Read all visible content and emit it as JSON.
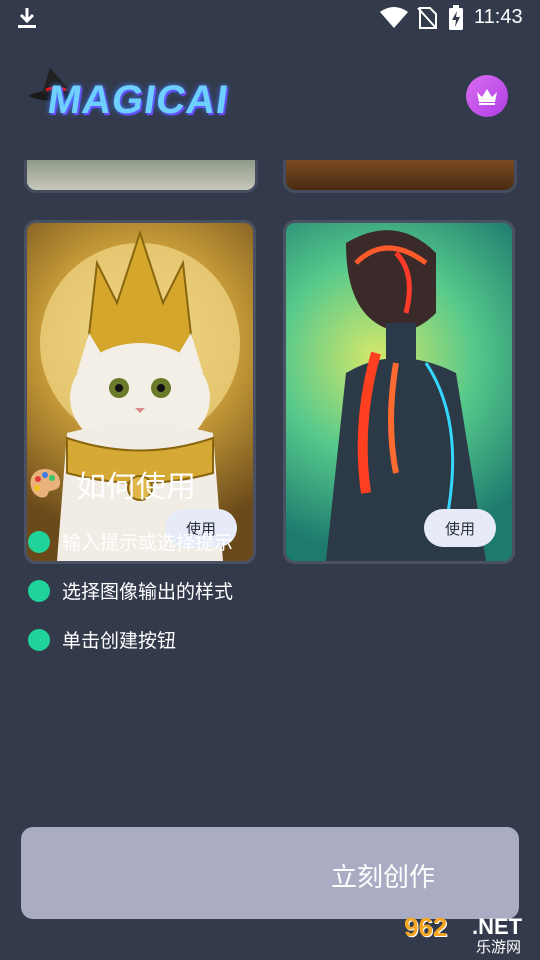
{
  "status_bar": {
    "time": "11:43"
  },
  "header": {
    "logo_text": "MAGICAI"
  },
  "cards": [
    {
      "name": "cat-king",
      "use_label": "使用"
    },
    {
      "name": "neon-robot",
      "use_label": "使用"
    }
  ],
  "howto": {
    "title": "如何使用",
    "steps": [
      "输入提示或选择提示",
      "选择图像输出的样式",
      "单击创建按钮"
    ]
  },
  "create_button": {
    "label": "立刻创作"
  },
  "watermark": {
    "number": "962",
    "net": ".NET",
    "subtitle": "乐游网"
  },
  "colors": {
    "background": "#333a4b",
    "accent_dot": "#1fd39a",
    "crown": "#c14ce8",
    "button": "#a9acc2"
  }
}
